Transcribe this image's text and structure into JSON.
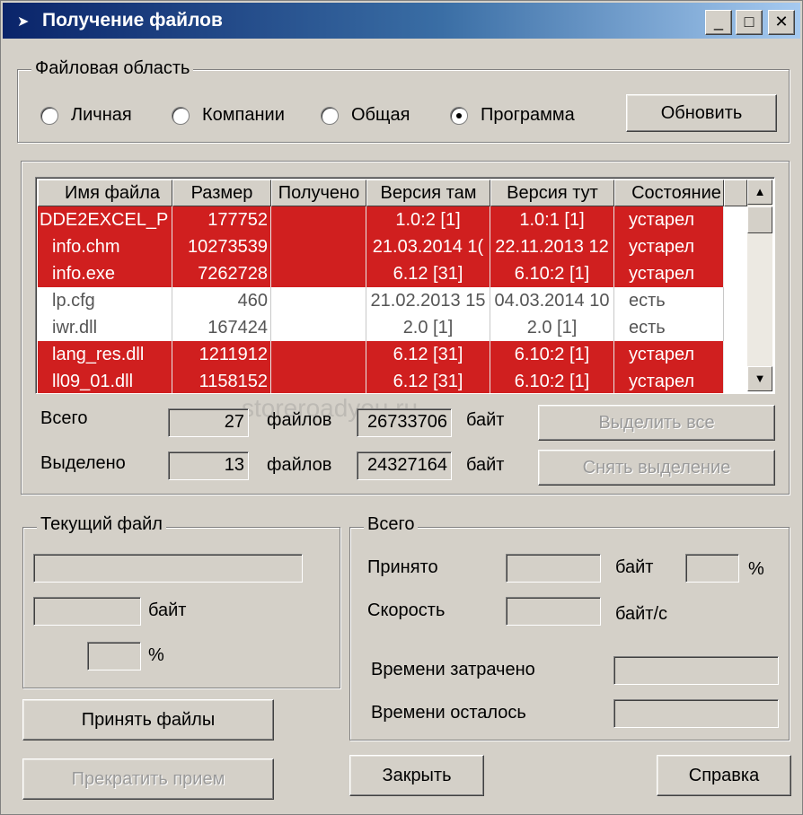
{
  "window": {
    "title": "Получение файлов",
    "icon": "arrow-icon",
    "controls": [
      "_",
      "□",
      "✕"
    ]
  },
  "file_area": {
    "legend": "Файловая область",
    "options": [
      {
        "label": "Личная",
        "checked": false
      },
      {
        "label": "Компании",
        "checked": false
      },
      {
        "label": "Общая",
        "checked": false
      },
      {
        "label": "Программа",
        "checked": true
      }
    ],
    "refresh_label": "Обновить"
  },
  "table": {
    "columns": [
      "Имя файла",
      "Размер",
      "Получено",
      "Версия там",
      "Версия тут",
      "Состояние"
    ],
    "rows": [
      {
        "name": "DDE2EXCEL_P",
        "size": "177752",
        "received": "",
        "ver_there": "1.0:2 [1]",
        "ver_here": "1.0:1 [1]",
        "state": "устарел",
        "highlight": true
      },
      {
        "name": "info.chm",
        "size": "10273539",
        "received": "",
        "ver_there": "21.03.2014  1(",
        "ver_here": "22.11.2013  12",
        "state": "устарел",
        "highlight": true
      },
      {
        "name": "info.exe",
        "size": "7262728",
        "received": "",
        "ver_there": "6.12 [31]",
        "ver_here": "6.10:2 [1]",
        "state": "устарел",
        "highlight": true
      },
      {
        "name": "lp.cfg",
        "size": "460",
        "received": "",
        "ver_there": "21.02.2013  15",
        "ver_here": "04.03.2014  10",
        "state": "есть",
        "highlight": false
      },
      {
        "name": "iwr.dll",
        "size": "167424",
        "received": "",
        "ver_there": "2.0 [1]",
        "ver_here": "2.0 [1]",
        "state": "есть",
        "highlight": false
      },
      {
        "name": "lang_res.dll",
        "size": "1211912",
        "received": "",
        "ver_there": "6.12 [31]",
        "ver_here": "6.10:2 [1]",
        "state": "устарел",
        "highlight": true
      },
      {
        "name": "ll09_01.dll",
        "size": "1158152",
        "received": "",
        "ver_there": "6.12 [31]",
        "ver_here": "6.10:2 [1]",
        "state": "устарел",
        "highlight": true
      }
    ],
    "highlight_color": "#d01f1f"
  },
  "totals": {
    "total_label": "Всего",
    "total_files": "27",
    "files_label": "файлов",
    "total_bytes": "26733706",
    "bytes_label": "байт",
    "selected_label": "Выделено",
    "selected_files": "13",
    "selected_bytes": "24327164",
    "select_all_label": "Выделить все",
    "deselect_label": "Снять выделение"
  },
  "current_file": {
    "legend": "Текущий файл",
    "bytes_label": "байт",
    "percent_label": "%"
  },
  "overall": {
    "legend": "Всего",
    "received_label": "Принято",
    "bytes_label": "байт",
    "percent_label": "%",
    "speed_label": "Скорость",
    "speed_unit": "байт/с",
    "time_spent_label": "Времени затрачено",
    "time_left_label": "Времени осталось"
  },
  "buttons": {
    "accept": "Принять файлы",
    "stop": "Прекратить прием",
    "close": "Закрыть",
    "help": "Справка"
  },
  "watermark": "storeroadyou.ru"
}
